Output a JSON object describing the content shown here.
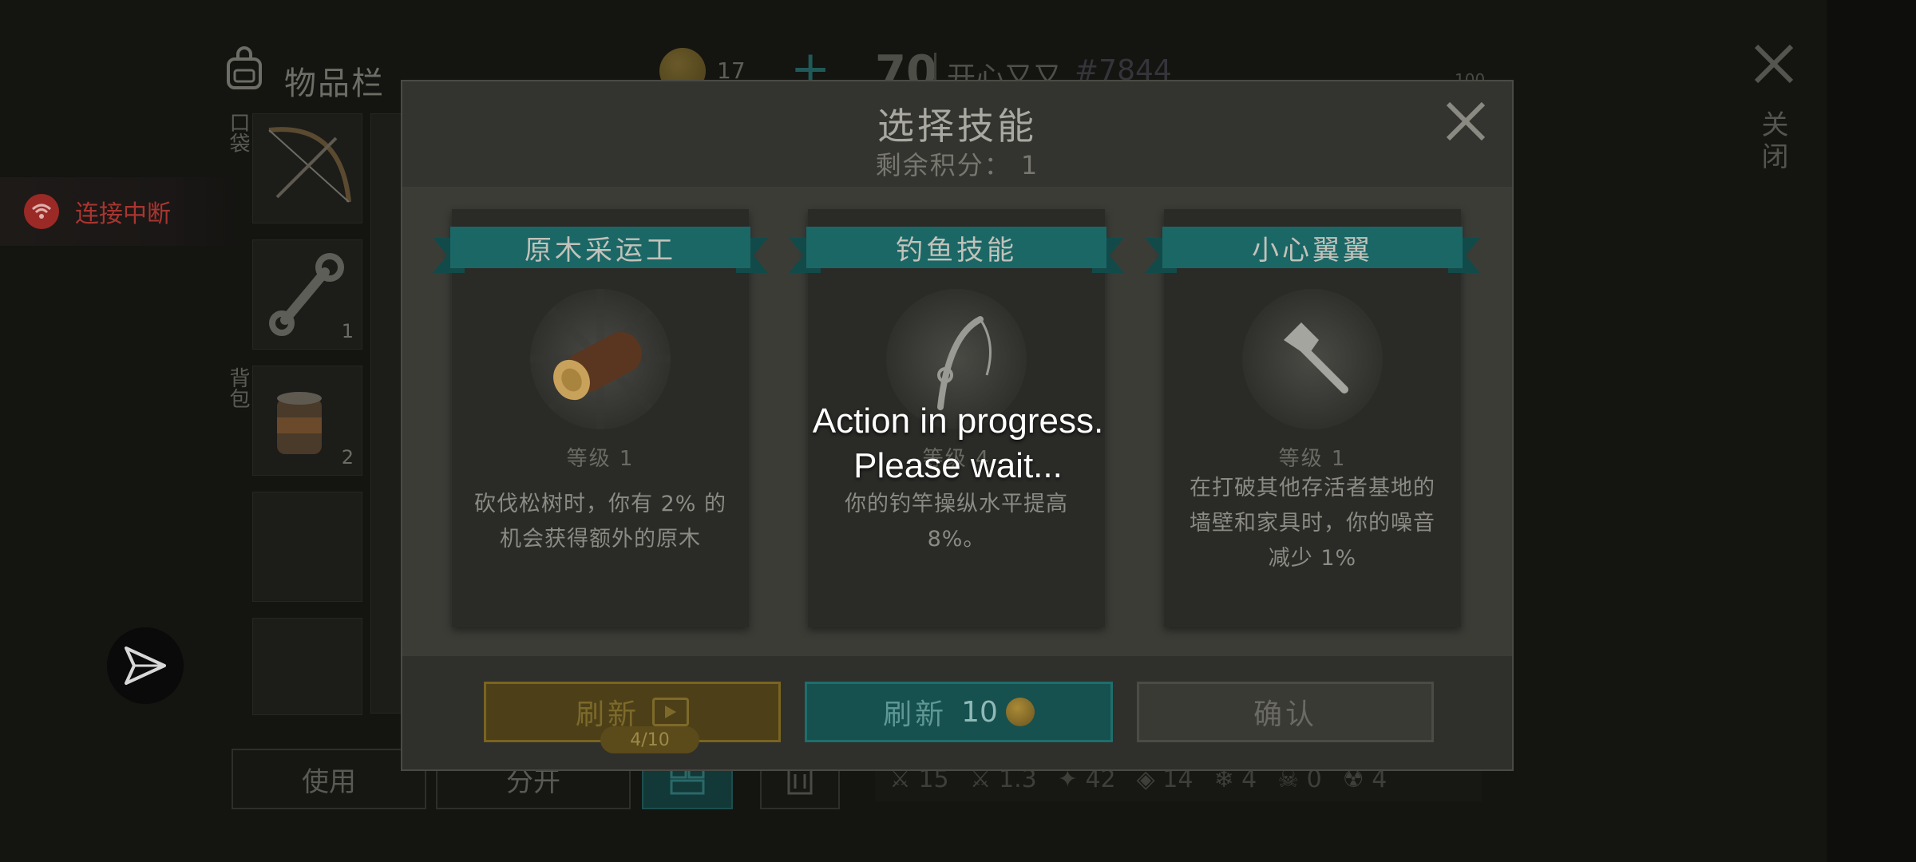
{
  "inventory": {
    "title": "物品栏",
    "coins": "17",
    "pocket_label": "口袋",
    "backpack_label": "背包",
    "slots": [
      {
        "count": ""
      },
      {
        "count": "1"
      },
      {
        "count": "2"
      }
    ],
    "buttons": {
      "use": "使用",
      "split": "分开"
    }
  },
  "player": {
    "level": "70",
    "name": "开心又又",
    "tag": "#7844",
    "top_value": "100"
  },
  "stats": [
    "15",
    "1.3",
    "42",
    "14",
    "4",
    "0",
    "4"
  ],
  "close_label": "关闭",
  "connection": {
    "status_text": "连接中断"
  },
  "modal": {
    "title": "选择技能",
    "points_label": "剩余积分：",
    "points_value": "1",
    "cards": [
      {
        "name": "原木采运工",
        "icon": "log-icon",
        "level": "等级 1",
        "desc": "砍伐松树时，你有 2% 的机会获得额外的原木"
      },
      {
        "name": "钓鱼技能",
        "icon": "fishing-rod-icon",
        "level": "等级 4",
        "desc": "你的钓竿操纵水平提高 8%。"
      },
      {
        "name": "小心翼翼",
        "icon": "axe-icon",
        "level": "等级 1",
        "desc": "在打破其他存活者基地的墙壁和家具时，你的噪音减少 1%"
      }
    ],
    "refresh_video_label": "刷新",
    "refresh_video_count": "4/10",
    "refresh_coin_label": "刷新",
    "refresh_coin_cost": "10",
    "confirm_label": "确认"
  },
  "toast": {
    "line1": "Action in progress.",
    "line2": "Please wait..."
  },
  "colors": {
    "teal": "#1b6766",
    "gold": "#7a6420",
    "alert_red": "#a93530"
  }
}
